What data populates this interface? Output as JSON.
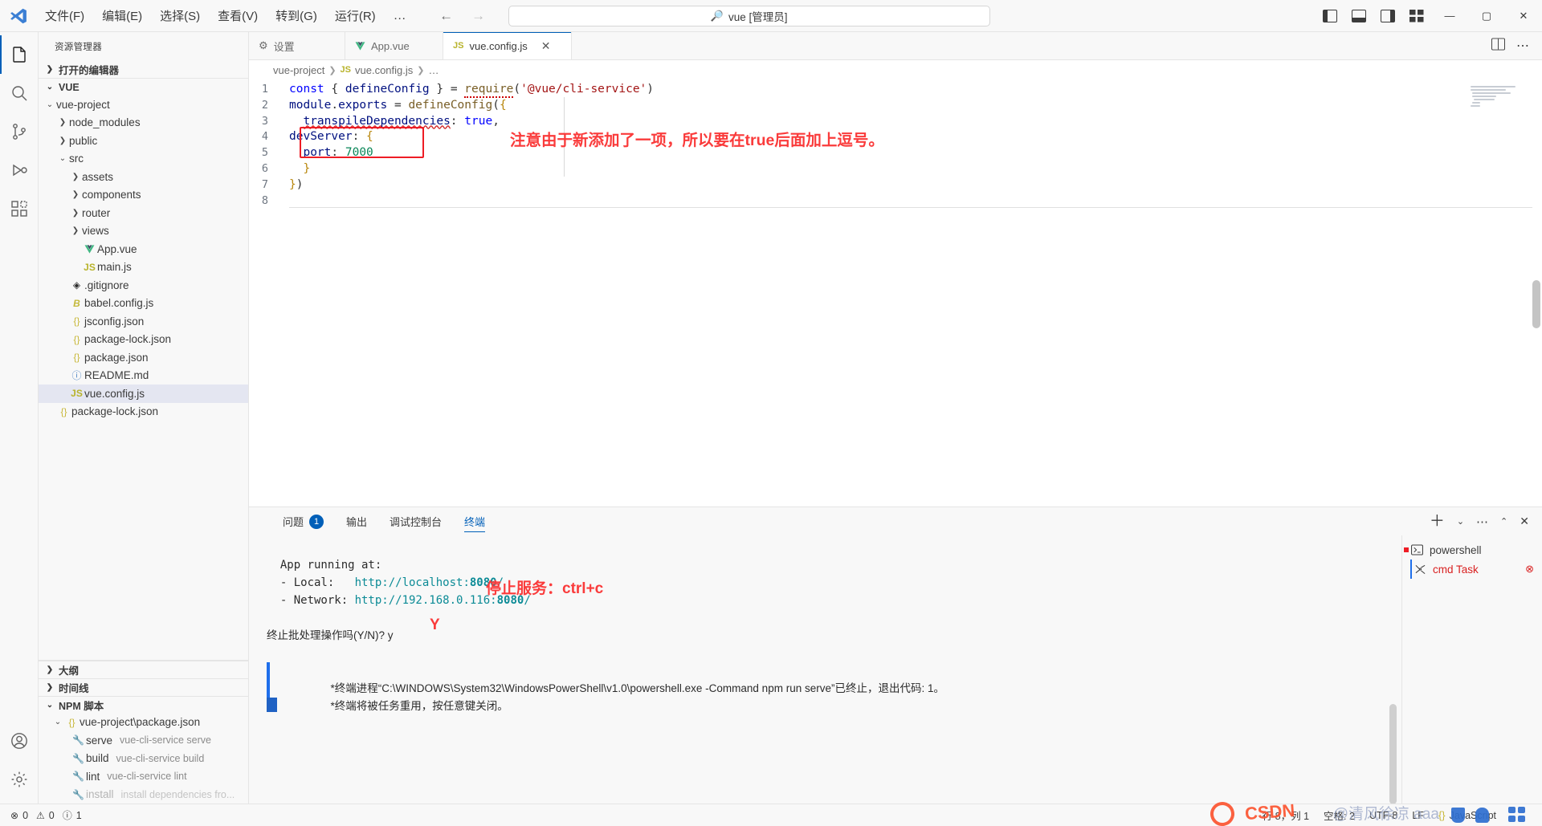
{
  "titlebar": {
    "logo_icon": "vscode-logo",
    "menus": [
      "文件(F)",
      "编辑(E)",
      "选择(S)",
      "查看(V)",
      "转到(G)",
      "运行(R)"
    ],
    "more_label": "…",
    "nav_back_icon": "arrow-left-icon",
    "nav_forward_icon": "arrow-right-icon",
    "search": {
      "icon": "search-icon",
      "value": "vue [管理员]"
    },
    "layout_icons": [
      "toggle-primary-sidebar-icon",
      "toggle-panel-icon",
      "toggle-secondary-sidebar-icon",
      "customize-layout-icon"
    ],
    "window_controls": {
      "minimize": "—",
      "maximize": "▢",
      "close": "✕"
    }
  },
  "activitybar": {
    "items": [
      {
        "name": "explorer",
        "icon": "files-icon",
        "active": true
      },
      {
        "name": "search",
        "icon": "search-icon",
        "active": false
      },
      {
        "name": "source-control",
        "icon": "source-control-icon",
        "active": false
      },
      {
        "name": "run-and-debug",
        "icon": "debug-icon",
        "active": false
      },
      {
        "name": "extensions",
        "icon": "extensions-icon",
        "active": false
      }
    ],
    "bottom": [
      {
        "name": "accounts",
        "icon": "account-icon"
      },
      {
        "name": "settings",
        "icon": "gear-icon"
      }
    ]
  },
  "sidebar": {
    "title": "资源管理器",
    "more_icon": "more-actions-icon",
    "open_editors_label": "打开的编辑器",
    "root_label": "VUE",
    "tree": [
      {
        "label": "vue-project",
        "depth": 1,
        "twisty": "v",
        "icon": "",
        "selected": false
      },
      {
        "label": "node_modules",
        "depth": 2,
        "twisty": ">",
        "icon": "",
        "selected": false
      },
      {
        "label": "public",
        "depth": 2,
        "twisty": ">",
        "icon": "",
        "selected": false
      },
      {
        "label": "src",
        "depth": 2,
        "twisty": "v",
        "icon": "",
        "selected": false
      },
      {
        "label": "assets",
        "depth": 3,
        "twisty": ">",
        "icon": "",
        "selected": false
      },
      {
        "label": "components",
        "depth": 3,
        "twisty": ">",
        "icon": "",
        "selected": false
      },
      {
        "label": "router",
        "depth": 3,
        "twisty": ">",
        "icon": "",
        "selected": false
      },
      {
        "label": "views",
        "depth": 3,
        "twisty": ">",
        "icon": "",
        "selected": false
      },
      {
        "label": "App.vue",
        "depth": 3,
        "twisty": "",
        "icon": "vue-icon",
        "selected": false
      },
      {
        "label": "main.js",
        "depth": 3,
        "twisty": "",
        "icon": "js-icon",
        "selected": false
      },
      {
        "label": ".gitignore",
        "depth": 2,
        "twisty": "",
        "icon": "git-icon",
        "selected": false
      },
      {
        "label": "babel.config.js",
        "depth": 2,
        "twisty": "",
        "icon": "babel-icon",
        "selected": false
      },
      {
        "label": "jsconfig.json",
        "depth": 2,
        "twisty": "",
        "icon": "json-icon",
        "selected": false
      },
      {
        "label": "package-lock.json",
        "depth": 2,
        "twisty": "",
        "icon": "json-icon",
        "selected": false
      },
      {
        "label": "package.json",
        "depth": 2,
        "twisty": "",
        "icon": "json-icon",
        "selected": false
      },
      {
        "label": "README.md",
        "depth": 2,
        "twisty": "",
        "icon": "md-icon",
        "selected": false
      },
      {
        "label": "vue.config.js",
        "depth": 2,
        "twisty": "",
        "icon": "js-icon",
        "selected": true
      },
      {
        "label": "package-lock.json",
        "depth": 1,
        "twisty": "",
        "icon": "json-icon",
        "selected": false
      }
    ],
    "outline_label": "大纲",
    "timeline_label": "时间线",
    "npm_label": "NPM 脚本",
    "npm_file": "vue-project\\package.json",
    "npm_scripts": [
      {
        "name": "serve",
        "cmd": "vue-cli-service serve",
        "dim": false
      },
      {
        "name": "build",
        "cmd": "vue-cli-service build",
        "dim": false
      },
      {
        "name": "lint",
        "cmd": "vue-cli-service lint",
        "dim": false
      },
      {
        "name": "install",
        "cmd": "install dependencies fro...",
        "dim": true
      }
    ]
  },
  "editor": {
    "tabs": [
      {
        "label": "设置",
        "icon": "gear-icon",
        "active": false,
        "closable": false
      },
      {
        "label": "App.vue",
        "icon": "vue-icon",
        "active": false,
        "closable": false
      },
      {
        "label": "vue.config.js",
        "icon": "js-icon",
        "active": true,
        "closable": true
      }
    ],
    "actions": [
      "split-editor-icon",
      "more-actions-icon"
    ],
    "breadcrumb": [
      "vue-project",
      "vue.config.js",
      "…"
    ],
    "breadcrumb_file_icon": "js-icon",
    "lines": [
      {
        "no": "1",
        "text": "const { defineConfig } = require('@vue/cli-service')"
      },
      {
        "no": "2",
        "text": "module.exports = defineConfig({"
      },
      {
        "no": "3",
        "text": "  transpileDependencies: true,"
      },
      {
        "no": "4",
        "text": "devServer: {"
      },
      {
        "no": "5",
        "text": "  port: 7000"
      },
      {
        "no": "6",
        "text": "  }"
      },
      {
        "no": "7",
        "text": "})"
      },
      {
        "no": "8",
        "text": ""
      }
    ],
    "annotation": "注意由于新添加了一项，所以要在true后面加上逗号。",
    "highlight_box": "devServer-port-block"
  },
  "panel": {
    "tabs": [
      {
        "label": "问题",
        "badge": "1",
        "active": false
      },
      {
        "label": "输出",
        "badge": "",
        "active": false
      },
      {
        "label": "调试控制台",
        "badge": "",
        "active": false
      },
      {
        "label": "终端",
        "badge": "",
        "active": true
      }
    ],
    "actions": [
      "add-terminal-icon",
      "chevron-down-icon",
      "more-actions-icon",
      "maximize-panel-icon",
      "close-panel-icon"
    ],
    "terminal_lines": [
      "  App running at:",
      "  - Local:   http://localhost:8080/",
      "  - Network: http://192.168.0.116:8080/"
    ],
    "terminal_local_url": "http://localhost:",
    "terminal_local_port": "8080",
    "terminal_network_url": "http://192.168.0.116:",
    "terminal_network_port": "8080",
    "prompt_line": "终止批处理操作吗(Y/N)? y",
    "note_stop": "停止服务：ctrl+c",
    "note_y": "Y",
    "exit_line_1": "终端进程“C:\\WINDOWS\\System32\\WindowsPowerShell\\v1.0\\powershell.exe -Command npm run serve”已终止，退出代码: 1。",
    "exit_line_2": "终端将被任务重用，按任意键关闭。",
    "terminal_list": [
      {
        "label": "powershell",
        "icon": "terminal-icon",
        "active": false,
        "is_task": false
      },
      {
        "label": "cmd  Task",
        "icon": "tools-icon",
        "active": true,
        "is_task": true,
        "kill_icon": "close-circle-icon"
      }
    ]
  },
  "statusbar": {
    "left": [
      {
        "icon": "error-icon",
        "label": "0"
      },
      {
        "icon": "warning-icon",
        "label": "0"
      },
      {
        "icon": "info-icon",
        "label": "1"
      }
    ],
    "right": [
      {
        "label": "行 8，列 1"
      },
      {
        "label": "空格: 2"
      },
      {
        "label": "UTF-8"
      },
      {
        "label": "LF"
      },
      {
        "label": "JavaScript",
        "icon": "json-icon"
      }
    ]
  },
  "watermark": {
    "brand": "CSDN",
    "user": "@清风徐凉 aaa"
  },
  "colors": {
    "accent": "#005fb8",
    "annotation_red": "#fa3b3b",
    "box_red": "#ee1c25",
    "selection": "#e4e6f1",
    "terminal_url": "#0c8b96"
  }
}
